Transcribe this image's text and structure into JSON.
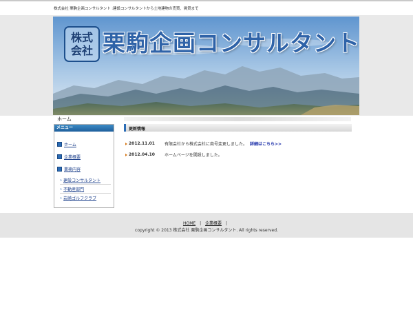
{
  "header": {
    "tagline": "株式会社 栗駒企画コンサルタント :建設コンサルタントから土地建物の売買、賃貸まで",
    "logo_line1": "株式",
    "logo_line2": "会社",
    "brand_name": "栗駒企画コンサルタント"
  },
  "nav": {
    "home_label": "ホーム"
  },
  "sidebar": {
    "menu_title": "メニュー",
    "items": [
      {
        "label": "ホーム"
      },
      {
        "label": "企業概要"
      },
      {
        "label": "業務内容"
      }
    ],
    "sub_items": [
      {
        "label": "建設コンサルタント"
      },
      {
        "label": "不動産部門"
      },
      {
        "label": "岩崎ゴルフクラブ"
      }
    ]
  },
  "news": {
    "title": "更新情報",
    "items": [
      {
        "date": "2012.11.01",
        "text": "有限会社から株式会社に商号変更しました。",
        "link": "詳細はこちら>>"
      },
      {
        "date": "2012.04.10",
        "text": "ホームページを開設しました。",
        "link": ""
      }
    ]
  },
  "footer": {
    "links": [
      "HOME",
      "企業概要"
    ],
    "separator": "|",
    "copyright": "copyright © 2013 株式会社 栗駒企画コンサルタント. All rights reserved."
  },
  "colors": {
    "accent": "#2b6cb5",
    "menu_header": "#1e5f9c",
    "link": "#1a2ea8",
    "bullet": "#d77b1e"
  }
}
